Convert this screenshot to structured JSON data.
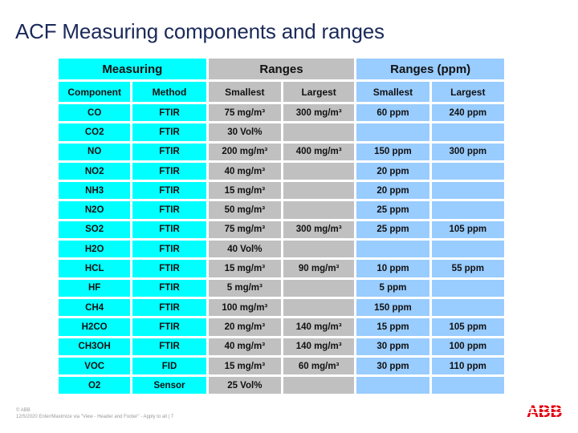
{
  "slide": {
    "title": "ACF Measuring components and ranges"
  },
  "table": {
    "group_headers": {
      "measuring": "Measuring",
      "ranges": "Ranges",
      "ranges_ppm": "Ranges (ppm)"
    },
    "column_headers": {
      "component": "Component",
      "method": "Method",
      "ranges_smallest": "Smallest",
      "ranges_largest": "Largest",
      "ppm_smallest": "Smallest",
      "ppm_largest": "Largest"
    },
    "colors": {
      "measuring": "#00ffff",
      "ranges": "#c0c0c0",
      "ranges_ppm": "#99ccff"
    },
    "rows": [
      {
        "component": "CO",
        "method": "FTIR",
        "smallest": "75 mg/m³",
        "largest": "300 mg/m³",
        "ppm_smallest": "60 ppm",
        "ppm_largest": "240 ppm"
      },
      {
        "component": "CO2",
        "method": "FTIR",
        "smallest": "30 Vol%",
        "largest": "",
        "ppm_smallest": "",
        "ppm_largest": ""
      },
      {
        "component": "NO",
        "method": "FTIR",
        "smallest": "200 mg/m³",
        "largest": "400 mg/m³",
        "ppm_smallest": "150 ppm",
        "ppm_largest": "300 ppm"
      },
      {
        "component": "NO2",
        "method": "FTIR",
        "smallest": "40 mg/m³",
        "largest": "",
        "ppm_smallest": "20 ppm",
        "ppm_largest": ""
      },
      {
        "component": "NH3",
        "method": "FTIR",
        "smallest": "15 mg/m³",
        "largest": "",
        "ppm_smallest": "20 ppm",
        "ppm_largest": ""
      },
      {
        "component": "N2O",
        "method": "FTIR",
        "smallest": "50 mg/m³",
        "largest": "",
        "ppm_smallest": "25 ppm",
        "ppm_largest": ""
      },
      {
        "component": "SO2",
        "method": "FTIR",
        "smallest": "75 mg/m³",
        "largest": "300 mg/m³",
        "ppm_smallest": "25 ppm",
        "ppm_largest": "105 ppm"
      },
      {
        "component": "H2O",
        "method": "FTIR",
        "smallest": "40 Vol%",
        "largest": "",
        "ppm_smallest": "",
        "ppm_largest": ""
      },
      {
        "component": "HCL",
        "method": "FTIR",
        "smallest": "15 mg/m³",
        "largest": "90 mg/m³",
        "ppm_smallest": "10 ppm",
        "ppm_largest": "55 ppm"
      },
      {
        "component": "HF",
        "method": "FTIR",
        "smallest": "5 mg/m³",
        "largest": "",
        "ppm_smallest": "5 ppm",
        "ppm_largest": ""
      },
      {
        "component": "CH4",
        "method": "FTIR",
        "smallest": "100 mg/m³",
        "largest": "",
        "ppm_smallest": "150 ppm",
        "ppm_largest": ""
      },
      {
        "component": "H2CO",
        "method": "FTIR",
        "smallest": "20 mg/m³",
        "largest": "140 mg/m³",
        "ppm_smallest": "15 ppm",
        "ppm_largest": "105 ppm"
      },
      {
        "component": "CH3OH",
        "method": "FTIR",
        "smallest": "40 mg/m³",
        "largest": "140 mg/m³",
        "ppm_smallest": "30 ppm",
        "ppm_largest": "100 ppm"
      },
      {
        "component": "VOC",
        "method": "FID",
        "smallest": "15 mg/m³",
        "largest": "60 mg/m³",
        "ppm_smallest": "30 ppm",
        "ppm_largest": "110 ppm"
      },
      {
        "component": "O2",
        "method": "Sensor",
        "smallest": "25 Vol%",
        "largest": "",
        "ppm_smallest": "",
        "ppm_largest": ""
      }
    ]
  },
  "footer": {
    "copyright": "© ABB",
    "info": "12/5/2020 Enter/Maximize via \"View - Header and Footer\" - Apply to all | 7"
  },
  "logo": {
    "text": "ABB",
    "color": "#e2000f",
    "icon": "abb-logo-icon"
  }
}
